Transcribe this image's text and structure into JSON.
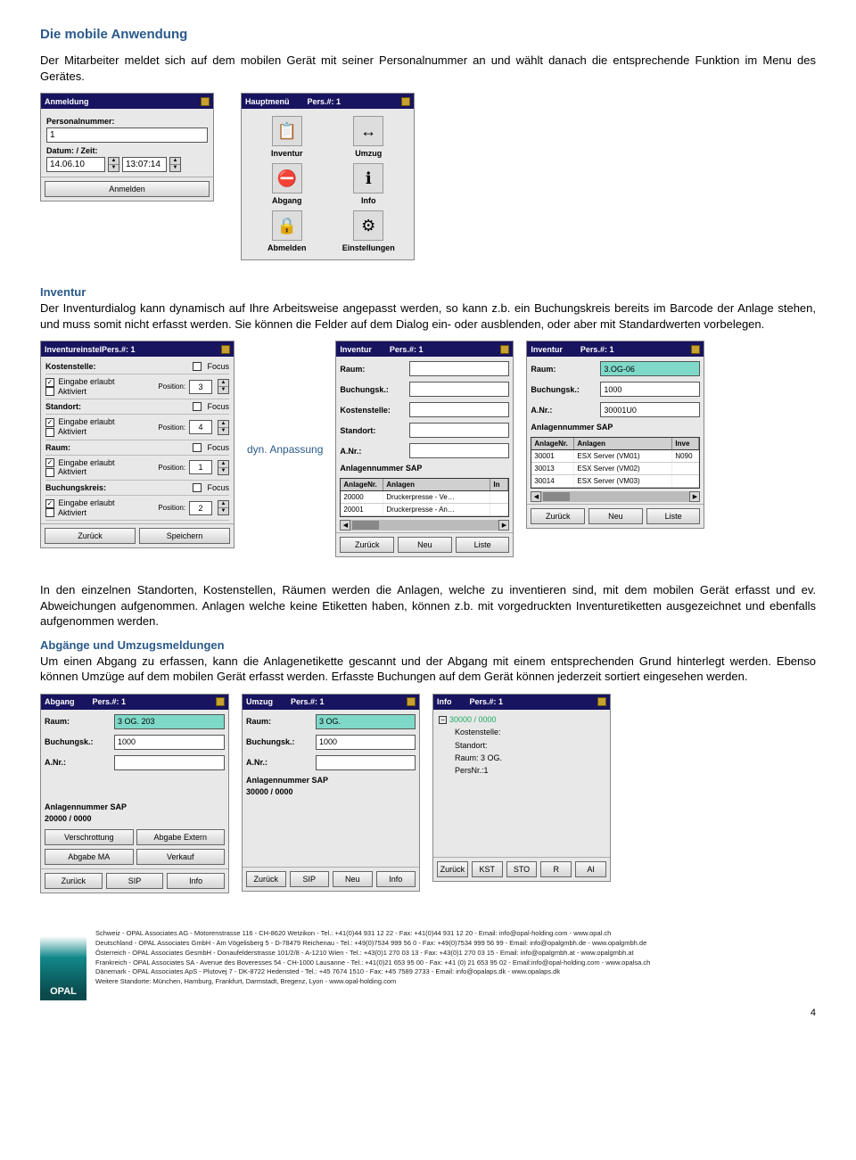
{
  "page_number": "4",
  "h1": "Die mobile Anwendung",
  "intro": "Der Mitarbeiter meldet sich auf dem mobilen Gerät mit seiner Personalnummer an und wählt danach die entsprechende Funktion im Menu des Gerätes.",
  "anmeldung": {
    "title": "Anmeldung",
    "lbl_persnr": "Personalnummer:",
    "persnr": "1",
    "lbl_datetime": "Datum: / Zeit:",
    "date": "14.06.10",
    "time": "13:07:14",
    "btn_login": "Anmelden"
  },
  "hauptmenu": {
    "title_l": "Hauptmenü",
    "title_r": "Pers.#: 1",
    "items": [
      {
        "icon": "📋",
        "label": "Inventur"
      },
      {
        "icon": "↔",
        "label": "Umzug"
      },
      {
        "icon": "⛔",
        "label": "Abgang"
      },
      {
        "icon": "ℹ",
        "label": "Info"
      },
      {
        "icon": "🔒",
        "label": "Abmelden"
      },
      {
        "icon": "⚙",
        "label": "Einstellungen"
      }
    ]
  },
  "inventur_heading": "Inventur",
  "inventur_text": "Der Inventurdialog kann dynamisch auf Ihre Arbeitsweise angepasst werden, so kann z.b. ein Buchungskreis bereits im Barcode der Anlage stehen, und muss somit nicht erfasst werden. Sie können die Felder auf dem Dialog ein- oder ausblenden, oder aber mit Standardwerten vorbelegen.",
  "anno_dyn": "dyn. Anpassung",
  "inv_settings": {
    "title_l": "InventureinstelPers.#: 1",
    "rows": [
      {
        "name": "Kostenstelle:",
        "focus": true,
        "ein": true,
        "akt": false,
        "pos": "3"
      },
      {
        "name": "Standort:",
        "focus": true,
        "ein": true,
        "akt": false,
        "pos": "4"
      },
      {
        "name": "Raum:",
        "focus": true,
        "ein": true,
        "akt": false,
        "pos": "1"
      },
      {
        "name": "Buchungskreis:",
        "focus": true,
        "ein": true,
        "akt": false,
        "pos": "2"
      }
    ],
    "lbl_ein": "Eingabe erlaubt",
    "lbl_akt": "Aktiviert",
    "lbl_pos": "Position:",
    "lbl_focus": "Focus",
    "btn_back": "Zurück",
    "btn_save": "Speichern"
  },
  "inv_empty": {
    "title_l": "Inventur",
    "title_r": "Pers.#: 1",
    "fields": [
      "Raum:",
      "Buchungsk.:",
      "Kostenstelle:",
      "Standort:",
      "A.Nr.:",
      "Anlagennummer SAP"
    ],
    "tbl_hd": [
      "AnlageNr.",
      "Anlagen",
      "In"
    ],
    "tbl_rows": [
      [
        "20000",
        "Druckerpresse - Ve…",
        ""
      ],
      [
        "20001",
        "Druckerpresse - An…",
        ""
      ]
    ],
    "btn_back": "Zurück",
    "btn_new": "Neu",
    "btn_list": "Liste"
  },
  "inv_filled": {
    "title_l": "Inventur",
    "title_r": "Pers.#: 1",
    "f_raum": "3.OG-06",
    "f_buk": "1000",
    "f_anr": "30001U0",
    "lbl_raum": "Raum:",
    "lbl_buk": "Buchungsk.:",
    "lbl_anr": "A.Nr.:",
    "lbl_sap": "Anlagennummer SAP",
    "tbl_hd": [
      "AnlageNr.",
      "Anlagen",
      "Inve"
    ],
    "tbl_rows": [
      [
        "30001",
        "ESX Server (VM01)",
        "N090"
      ],
      [
        "30013",
        "ESX Server (VM02)",
        ""
      ],
      [
        "30014",
        "ESX Server (VM03)",
        ""
      ]
    ],
    "btn_back": "Zurück",
    "btn_new": "Neu",
    "btn_list": "Liste"
  },
  "para_inv": "In den einzelnen Standorten, Kostenstellen, Räumen werden die Anlagen, welche zu inventieren sind, mit dem mobilen Gerät erfasst und ev. Abweichungen aufgenommen.  Anlagen welche keine Etiketten haben, können z.b. mit vorgedruckten Inventuretiketten  ausgezeichnet und ebenfalls aufgenommen werden.",
  "h_abg": "Abgänge und Umzugsmeldungen",
  "para_abg": "Um einen Abgang zu erfassen, kann die Anlagenetikette gescannt und der Abgang mit einem entsprechenden Grund hinterlegt werden. Ebenso können Umzüge auf dem mobilen Gerät erfasst werden. Erfasste Buchungen auf dem Gerät können jederzeit sortiert eingesehen werden.",
  "abgang": {
    "title_l": "Abgang",
    "title_r": "Pers.#: 1",
    "lbl_raum": "Raum:",
    "v_raum": "3 OG. 203",
    "lbl_buk": "Buchungsk.:",
    "v_buk": "1000",
    "lbl_anr": "A.Nr.:",
    "lbl_sap": "Anlagennummer SAP",
    "v_sap": "20000 / 0000",
    "opts": [
      "Verschrottung",
      "Abgabe Extern",
      "Abgabe MA",
      "Verkauf"
    ],
    "btns": [
      "Zurück",
      "SIP",
      "Info"
    ]
  },
  "umzug": {
    "title_l": "Umzug",
    "title_r": "Pers.#: 1",
    "lbl_raum": "Raum:",
    "v_raum": "3 OG.",
    "lbl_buk": "Buchungsk.:",
    "v_buk": "1000",
    "lbl_anr": "A.Nr.:",
    "lbl_sap": "Anlagennummer SAP",
    "v_sap": "30000 / 0000",
    "btns": [
      "Zurück",
      "SIP",
      "Neu",
      "Info"
    ]
  },
  "info": {
    "title_l": "Info",
    "title_r": "Pers.#: 1",
    "code": "30000 / 0000",
    "lines": [
      "Kostenstelle:",
      "Standort:",
      "Raum: 3 OG.",
      "PersNr.:1"
    ],
    "btns": [
      "Zurück",
      "KST",
      "STO",
      "R",
      "AI"
    ]
  },
  "footer": {
    "logo": "OPAL",
    "lines": [
      "Schweiz - OPAL Associates AG - Motorenstrasse 116 - CH-8620 Wetzikon - Tel.: +41(0)44 931 12 22 - Fax: +41(0)44 931 12 20 - Email: info@opal-holding.com - www.opal.ch",
      "Deutschland - OPAL Associates GmbH - Am Vögelisberg 5 - D-78479 Reichenau - Tel.: +49(0)7534 999 56 0 - Fax: +49(0)7534 999 56 99 - Email: info@opalgmbh.de - www.opalgmbh.de",
      "Österreich - OPAL Associates GesmbH - Donaufelderstrasse 101/2/8 - A-1210 Wien - Tel.: +43(0)1 270 03 13 - Fax: +43(0)1 270 03 15 - Email: info@opalgmbh.at - www.opalgmbh.at",
      "Frankreich - OPAL Associates SA - Avenue des Boveresses 54 - CH-1000 Lausanne - Tel.: +41(0)21 653 95 00 - Fax: +41 (0) 21 653 95 02 - Email:info@opal-holding.com - www.opalsa.ch",
      "Dänemark - OPAL Associates ApS - Plutovej 7 - DK-8722 Hedensted - Tel.: +45 7674 1510 - Fax: +45 7589 2733 - Email: info@opalaps.dk - www.opalaps.dk",
      "Weitere Standorte: München, Hamburg, Frankfurt, Darmstadt, Bregenz, Lyon  -  www.opal-holding.com"
    ]
  }
}
